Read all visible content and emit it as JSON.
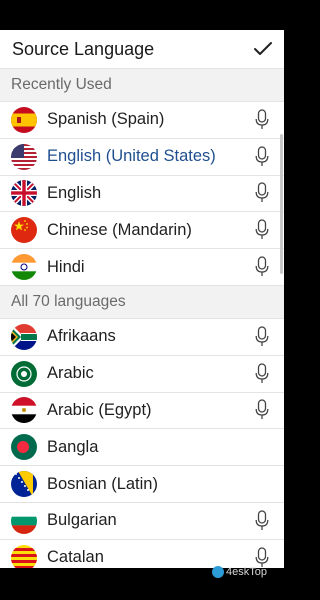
{
  "header": {
    "title": "Source Language"
  },
  "sections": {
    "recent": {
      "label": "Recently Used",
      "items": [
        {
          "label": "Spanish (Spain)",
          "flag": "spain-flag",
          "mic": true,
          "selected": false
        },
        {
          "label": "English (United States)",
          "flag": "usa-flag",
          "mic": true,
          "selected": true
        },
        {
          "label": "English",
          "flag": "uk-flag",
          "mic": true,
          "selected": false
        },
        {
          "label": "Chinese (Mandarin)",
          "flag": "china-flag",
          "mic": true,
          "selected": false
        },
        {
          "label": "Hindi",
          "flag": "india-flag",
          "mic": true,
          "selected": false
        }
      ]
    },
    "all": {
      "label": "All 70 languages",
      "items": [
        {
          "label": "Afrikaans",
          "flag": "south-africa-flag",
          "mic": true
        },
        {
          "label": "Arabic",
          "flag": "arab-league-flag",
          "mic": true
        },
        {
          "label": "Arabic (Egypt)",
          "flag": "egypt-flag",
          "mic": true
        },
        {
          "label": "Bangla",
          "flag": "bangladesh-flag",
          "mic": false
        },
        {
          "label": "Bosnian (Latin)",
          "flag": "bosnia-flag",
          "mic": false
        },
        {
          "label": "Bulgarian",
          "flag": "bulgaria-flag",
          "mic": true
        },
        {
          "label": "Catalan",
          "flag": "catalonia-flag",
          "mic": true
        }
      ]
    }
  },
  "watermark": "4eskTop",
  "colors": {
    "selected_text": "#1f4f8f",
    "section_bg": "#f2f2f2",
    "divider": "#e3e3e3"
  }
}
